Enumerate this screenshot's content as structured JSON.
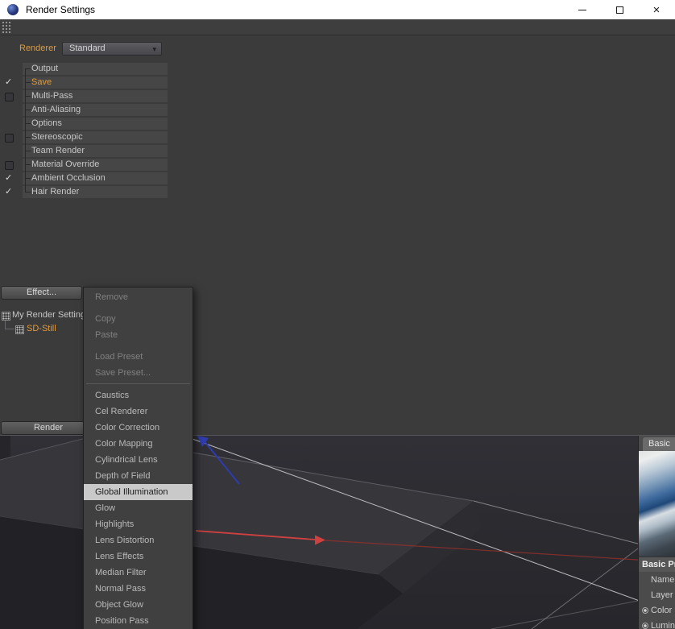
{
  "window": {
    "title": "Render Settings"
  },
  "icons": {
    "close": "×",
    "check": "✓",
    "dropdown_arrow": "▾"
  },
  "renderer_row": {
    "label": "Renderer",
    "value": "Standard"
  },
  "settings_tree": {
    "items": [
      {
        "label": "Output",
        "check": "check-none"
      },
      {
        "label": "Save",
        "check": "check-on",
        "state": "selected"
      },
      {
        "label": "Multi-Pass",
        "check": "check-off"
      },
      {
        "label": "Anti-Aliasing",
        "check": "check-none"
      },
      {
        "label": "Options",
        "check": "check-none"
      },
      {
        "label": "Stereoscopic",
        "check": "check-off"
      },
      {
        "label": "Team Render",
        "check": "check-none"
      },
      {
        "label": "Material Override",
        "check": "check-off"
      },
      {
        "label": "Ambient Occlusion",
        "check": "check-on"
      },
      {
        "label": "Hair Render",
        "check": "check-on"
      }
    ]
  },
  "buttons": {
    "effect": "Effect...",
    "render": "Render"
  },
  "preset_tree": {
    "items": [
      {
        "label": "My Render Setting",
        "level": "lvl1"
      },
      {
        "label": "SD-Still",
        "level": "lvl2",
        "tone": "accent"
      }
    ]
  },
  "context_menu": {
    "items": [
      {
        "label": "Remove",
        "state": "disabled",
        "sep": "sep-gap"
      },
      {
        "label": "Copy",
        "state": "disabled"
      },
      {
        "label": "Paste",
        "state": "disabled",
        "sep": "sep-gap"
      },
      {
        "label": "Load Preset",
        "state": "disabled"
      },
      {
        "label": "Save Preset...",
        "state": "disabled",
        "sep": "sep-line"
      },
      {
        "label": "Caustics"
      },
      {
        "label": "Cel Renderer"
      },
      {
        "label": "Color Correction"
      },
      {
        "label": "Color Mapping"
      },
      {
        "label": "Cylindrical Lens"
      },
      {
        "label": "Depth of Field"
      },
      {
        "label": "Global Illumination",
        "state": "highlighted"
      },
      {
        "label": "Glow"
      },
      {
        "label": "Highlights"
      },
      {
        "label": "Lens Distortion"
      },
      {
        "label": "Lens Effects"
      },
      {
        "label": "Median Filter"
      },
      {
        "label": "Normal Pass"
      },
      {
        "label": "Object Glow"
      },
      {
        "label": "Position Pass"
      }
    ]
  },
  "material_panel": {
    "tab": "Basic",
    "section": "Basic Properties",
    "rows": [
      {
        "label": "Name",
        "radio": "radio-none"
      },
      {
        "label": "Layer",
        "radio": "radio-none"
      },
      {
        "label": "Color",
        "radio": "radio-on"
      },
      {
        "label": "Luminance",
        "radio": "radio-on"
      }
    ]
  },
  "colors": {
    "accent_orange": "#e09b3a",
    "menu_highlight": "#c9c9c9",
    "window_bg": "#3b3b3b",
    "row_bar": "#464646",
    "axis_red": "#cf4040",
    "axis_blue": "#2e3cae"
  }
}
